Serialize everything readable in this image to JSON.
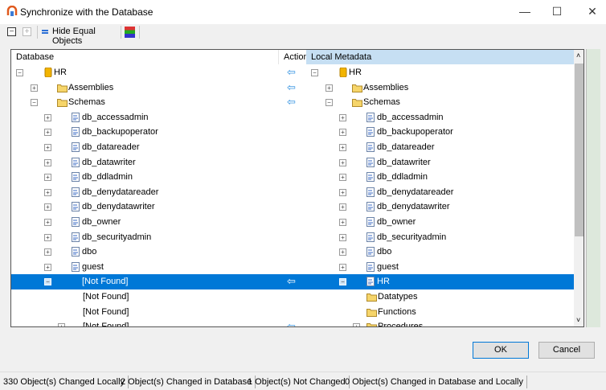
{
  "window": {
    "title": "Synchronize with the Database",
    "minimize": "—",
    "maximize": "☐",
    "close": "✕"
  },
  "toolbar": {
    "hide_equal": "Hide Equal Objects"
  },
  "headers": {
    "database": "Database",
    "action": "Action",
    "local": "Local Metadata"
  },
  "rows": [
    {
      "l": {
        "lvl": 0,
        "exp": "−",
        "icon": "database",
        "text": "HR"
      },
      "arrow": true,
      "r": {
        "lvl": 0,
        "exp": "−",
        "icon": "database",
        "text": "HR"
      }
    },
    {
      "l": {
        "lvl": 1,
        "exp": "+",
        "icon": "folder",
        "text": "Assemblies"
      },
      "arrow": true,
      "r": {
        "lvl": 1,
        "exp": "+",
        "icon": "folder",
        "text": "Assemblies"
      }
    },
    {
      "l": {
        "lvl": 1,
        "exp": "−",
        "icon": "folder",
        "text": "Schemas"
      },
      "arrow": true,
      "r": {
        "lvl": 1,
        "exp": "−",
        "icon": "folder",
        "text": "Schemas"
      }
    },
    {
      "l": {
        "lvl": 2,
        "exp": "+",
        "icon": "schema",
        "text": "db_accessadmin"
      },
      "r": {
        "lvl": 2,
        "exp": "+",
        "icon": "schema",
        "text": "db_accessadmin"
      }
    },
    {
      "l": {
        "lvl": 2,
        "exp": "+",
        "icon": "schema",
        "text": "db_backupoperator"
      },
      "r": {
        "lvl": 2,
        "exp": "+",
        "icon": "schema",
        "text": "db_backupoperator"
      }
    },
    {
      "l": {
        "lvl": 2,
        "exp": "+",
        "icon": "schema",
        "text": "db_datareader"
      },
      "r": {
        "lvl": 2,
        "exp": "+",
        "icon": "schema",
        "text": "db_datareader"
      }
    },
    {
      "l": {
        "lvl": 2,
        "exp": "+",
        "icon": "schema",
        "text": "db_datawriter"
      },
      "r": {
        "lvl": 2,
        "exp": "+",
        "icon": "schema",
        "text": "db_datawriter"
      }
    },
    {
      "l": {
        "lvl": 2,
        "exp": "+",
        "icon": "schema",
        "text": "db_ddladmin"
      },
      "r": {
        "lvl": 2,
        "exp": "+",
        "icon": "schema",
        "text": "db_ddladmin"
      }
    },
    {
      "l": {
        "lvl": 2,
        "exp": "+",
        "icon": "schema",
        "text": "db_denydatareader"
      },
      "r": {
        "lvl": 2,
        "exp": "+",
        "icon": "schema",
        "text": "db_denydatareader"
      }
    },
    {
      "l": {
        "lvl": 2,
        "exp": "+",
        "icon": "schema",
        "text": "db_denydatawriter"
      },
      "r": {
        "lvl": 2,
        "exp": "+",
        "icon": "schema",
        "text": "db_denydatawriter"
      }
    },
    {
      "l": {
        "lvl": 2,
        "exp": "+",
        "icon": "schema",
        "text": "db_owner"
      },
      "r": {
        "lvl": 2,
        "exp": "+",
        "icon": "schema",
        "text": "db_owner"
      }
    },
    {
      "l": {
        "lvl": 2,
        "exp": "+",
        "icon": "schema",
        "text": "db_securityadmin"
      },
      "r": {
        "lvl": 2,
        "exp": "+",
        "icon": "schema",
        "text": "db_securityadmin"
      }
    },
    {
      "l": {
        "lvl": 2,
        "exp": "+",
        "icon": "schema",
        "text": "dbo"
      },
      "r": {
        "lvl": 2,
        "exp": "+",
        "icon": "schema",
        "text": "dbo"
      }
    },
    {
      "l": {
        "lvl": 2,
        "exp": "+",
        "icon": "schema",
        "text": "guest"
      },
      "r": {
        "lvl": 2,
        "exp": "+",
        "icon": "schema",
        "text": "guest"
      }
    },
    {
      "selected": true,
      "l": {
        "lvl": 2,
        "exp": "−",
        "icon": "none",
        "text": "[Not Found]"
      },
      "arrow": true,
      "r": {
        "lvl": 2,
        "exp": "−",
        "icon": "schema",
        "text": "HR"
      }
    },
    {
      "l": {
        "lvl": 3,
        "icon": "none",
        "text": "[Not Found]"
      },
      "r": {
        "lvl": 3,
        "icon": "folder",
        "text": "Datatypes"
      }
    },
    {
      "l": {
        "lvl": 3,
        "icon": "none",
        "text": "[Not Found]"
      },
      "r": {
        "lvl": 3,
        "icon": "folder",
        "text": "Functions"
      }
    },
    {
      "l": {
        "lvl": 3,
        "exp": "+",
        "icon": "none",
        "text": "[Not Found]"
      },
      "arrow": true,
      "r": {
        "lvl": 3,
        "exp": "+",
        "icon": "folder",
        "text": "Procedures"
      }
    }
  ],
  "buttons": {
    "ok": "OK",
    "cancel": "Cancel"
  },
  "status": [
    "330 Object(s) Changed Locally",
    "2 Object(s) Changed in Database",
    "1 Object(s) Not Changed",
    "0 Object(s) Changed in Database and Locally"
  ],
  "colors": {
    "selection": "#0078d7",
    "header_active": "#c6dff3",
    "arrow": "#2b8ee0"
  }
}
